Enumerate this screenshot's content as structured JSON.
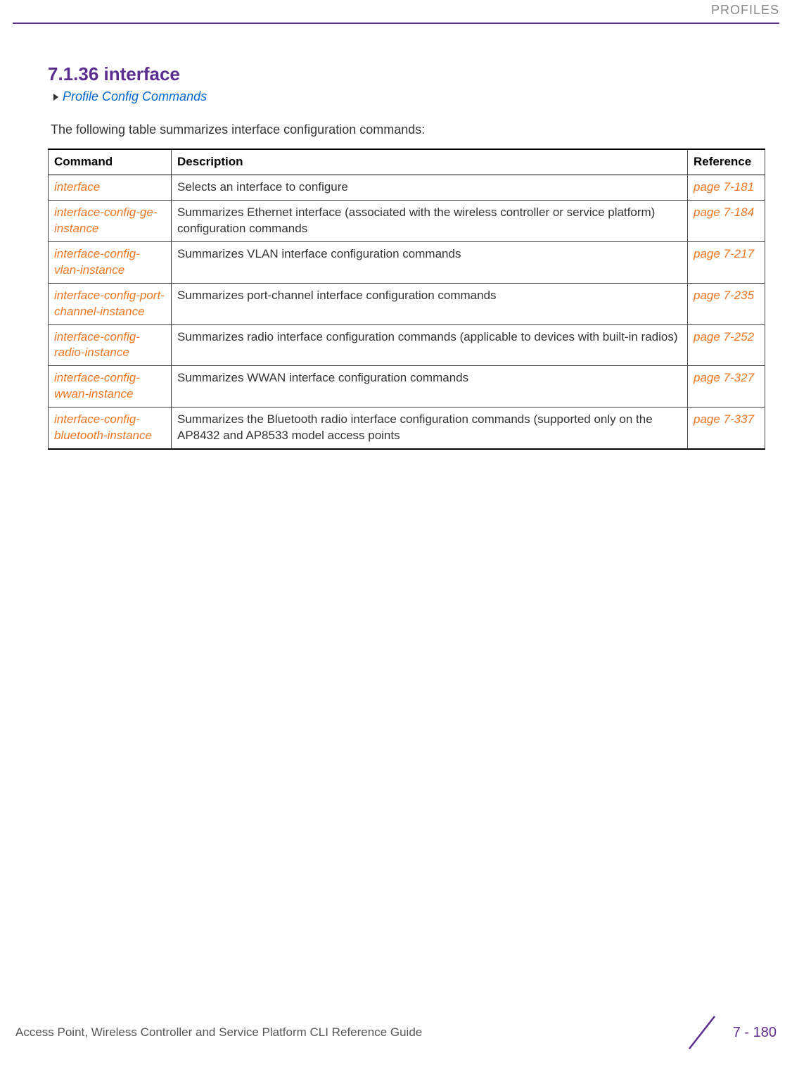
{
  "header": {
    "section_label": "PROFILES"
  },
  "content": {
    "heading": "7.1.36 interface",
    "breadcrumb": "Profile Config Commands",
    "intro": "The following table summarizes interface configuration commands:"
  },
  "table": {
    "headers": {
      "command": "Command",
      "description": "Description",
      "reference": "Reference"
    },
    "rows": [
      {
        "command": "interface",
        "description": "Selects an interface to configure",
        "reference": "page 7-181"
      },
      {
        "command": "interface-config-ge-instance",
        "description": "Summarizes Ethernet interface (associated with the wireless controller or service platform) configuration commands",
        "reference": "page 7-184"
      },
      {
        "command": "interface-config-vlan-instance",
        "description": "Summarizes VLAN interface configuration commands",
        "reference": "page 7-217"
      },
      {
        "command": "interface-config-port-channel-instance",
        "description": "Summarizes port-channel interface configuration commands",
        "reference": "page 7-235"
      },
      {
        "command": "interface-config-radio-instance",
        "description": "Summarizes radio interface configuration commands (applicable to devices with built-in radios)",
        "reference": "page 7-252"
      },
      {
        "command": "interface-config-wwan-instance",
        "description": "Summarizes WWAN interface configuration commands",
        "reference": "page 7-327"
      },
      {
        "command": "interface-config-bluetooth-instance",
        "description": "Summarizes the Bluetooth radio interface configuration commands (supported only on the AP8432 and AP8533 model access points",
        "reference": "page 7-337"
      }
    ]
  },
  "footer": {
    "guide_title": "Access Point, Wireless Controller and Service Platform CLI Reference Guide",
    "page_number": "7 - 180"
  }
}
